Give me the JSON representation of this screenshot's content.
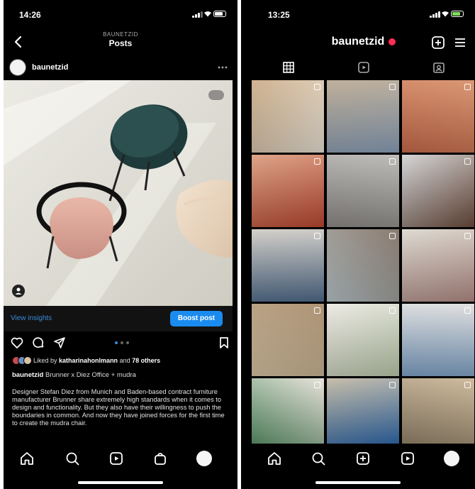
{
  "left": {
    "status_time": "14:26",
    "header": {
      "subtitle": "BAUNETZID",
      "title": "Posts"
    },
    "post": {
      "username": "baunetzid",
      "insights_label": "View insights",
      "boost_label": "Boost post",
      "likes_prefix": "Liked by",
      "likes_user": "katharinahonlmann",
      "likes_mid": "and",
      "likes_others": "78 others",
      "caption_user": "baunetzid",
      "caption_text": "Brunner x Diez Office + mudra",
      "caption_body": "Designer Stefan Diez from Munich and Baden-based contract furniture manufacturer Brunner share extremely high standards when it comes to design and functionality. But they also have their willingness to push the boundaries in common. And now they have joined forces for the first time to create the mudra chair."
    }
  },
  "right": {
    "status_time": "13:25",
    "profile_name": "baunetzid",
    "grid_colors": [
      [
        "#c9a882",
        "#e8e1d4"
      ],
      [
        "#b7a58d",
        "#8a9fb8"
      ],
      [
        "#d58a62",
        "#c76a4a"
      ],
      [
        "#d9987a",
        "#b9462f"
      ],
      [
        "#b5b3b0",
        "#8c8986"
      ],
      [
        "#d0d1d3",
        "#6a4a3a"
      ],
      [
        "#cfcac3",
        "#4f6b8a"
      ],
      [
        "#7b6a5c",
        "#b8c5c9"
      ],
      [
        "#d9d6cc",
        "#b28a84"
      ],
      [
        "#a48664",
        "#d6c3a3"
      ],
      [
        "#ebe8e2",
        "#b9c7a9"
      ],
      [
        "#dcdcdc",
        "#7ea1c6"
      ],
      [
        "#e4dfd5",
        "#4f8a5f"
      ],
      [
        "#c0b59f",
        "#1f5fa8"
      ],
      [
        "#c8b291",
        "#8a7b63"
      ]
    ]
  },
  "colors": {
    "accent": "#1a8cf0",
    "link": "#3a8bd8",
    "notification": "#ff2d55"
  },
  "icons": [
    "back-icon",
    "more-icon",
    "heart-icon",
    "comment-icon",
    "share-icon",
    "bookmark-icon",
    "home-icon",
    "search-icon",
    "reels-icon",
    "shop-icon",
    "add-icon",
    "menu-icon",
    "grid-icon",
    "tagged-icon"
  ]
}
